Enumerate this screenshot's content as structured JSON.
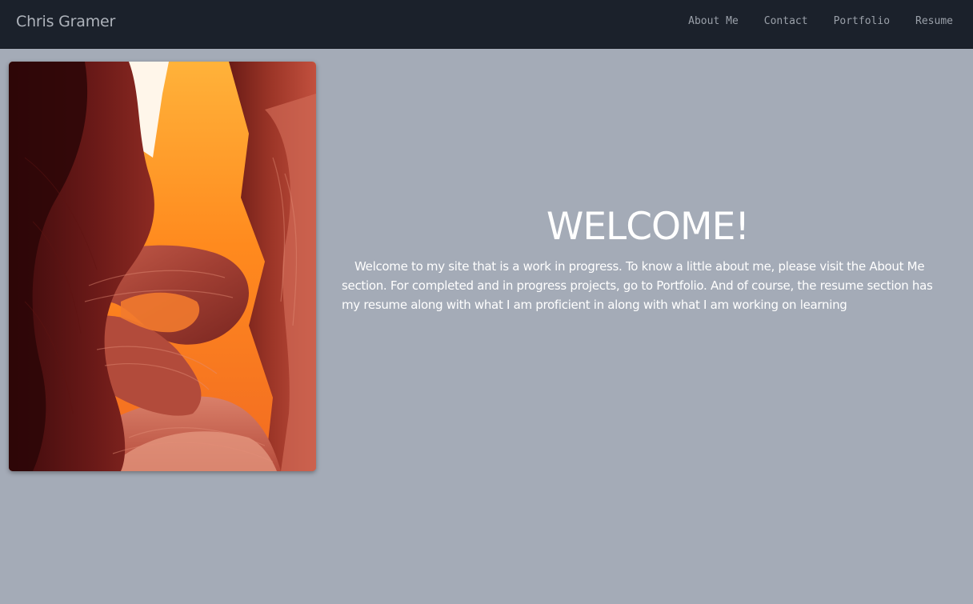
{
  "navbar": {
    "brand": "Chris Gramer",
    "links": [
      {
        "label": "About Me"
      },
      {
        "label": "Contact"
      },
      {
        "label": "Portfolio"
      },
      {
        "label": "Resume"
      }
    ]
  },
  "hero": {
    "image_subject": "canyon-photo"
  },
  "welcome": {
    "title": "WELCOME!",
    "text": "Welcome to my site that is a work in progress. To know a little about me, please visit the About Me section. For completed and in progress projects, go to Portfolio. And of course, the resume section has my resume along with what I am proficient in along with what I am working on learning"
  },
  "colors": {
    "page_background": "#a4abb7",
    "navbar_background": "#1b212b",
    "nav_text": "#9aa0a9",
    "welcome_text": "#ffffff"
  }
}
